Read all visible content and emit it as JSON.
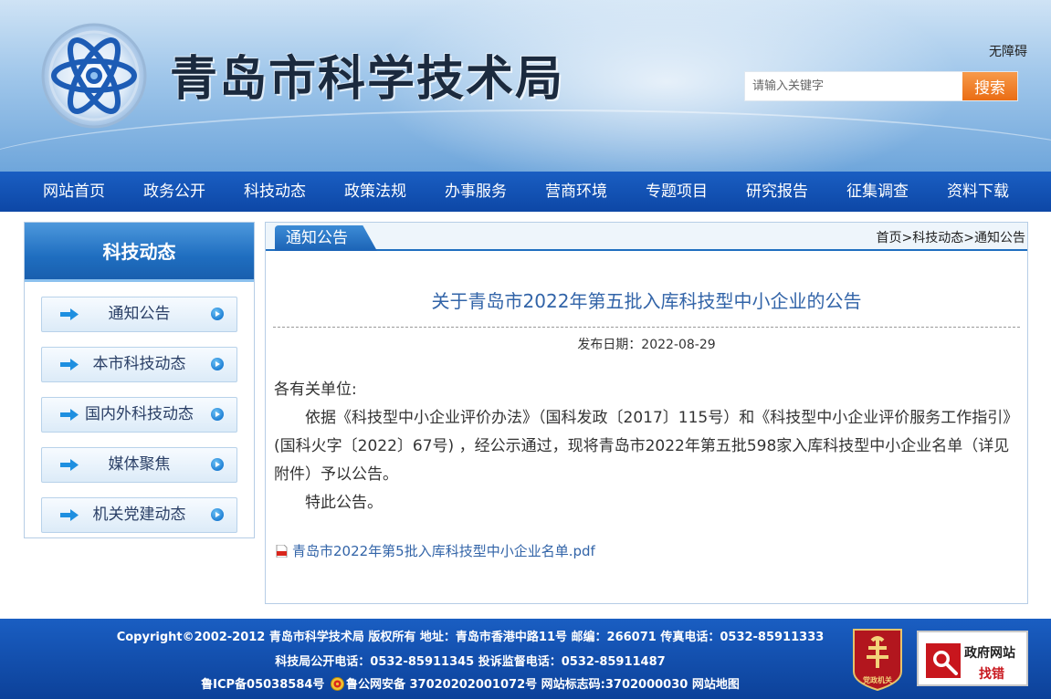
{
  "header": {
    "site_title": "青岛市科学技术局",
    "accessibility_link": "无障碍",
    "search_placeholder": "请输入关键字",
    "search_button": "搜索"
  },
  "nav": {
    "items": [
      "网站首页",
      "政务公开",
      "科技动态",
      "政策法规",
      "办事服务",
      "营商环境",
      "专题项目",
      "研究报告",
      "征集调查",
      "资料下载"
    ]
  },
  "sidebar": {
    "title": "科技动态",
    "items": [
      "通知公告",
      "本市科技动态",
      "国内外科技动态",
      "媒体聚焦",
      "机关党建动态"
    ]
  },
  "panel": {
    "tab_label": "通知公告",
    "breadcrumb": [
      "首页",
      "科技动态",
      "通知公告"
    ],
    "breadcrumb_sep": ">"
  },
  "article": {
    "title": "关于青岛市2022年第五批入库科技型中小企业的公告",
    "publish_date": "发布日期：2022-08-29",
    "salutation": "各有关单位:",
    "paragraph1": "依据《科技型中小企业评价办法》（国科发政〔2017〕115号）和《科技型中小企业评价服务工作指引》(国科火字〔2022〕67号) ，经公示通过，现将青岛市2022年第五批598家入库科技型中小企业名单（详见附件）予以公告。",
    "paragraph2": "特此公告。",
    "attachment": "青岛市2022年第5批入库科技型中小企业名单.pdf"
  },
  "footer": {
    "line1": "Copyright©2002-2012 青岛市科学技术局 版权所有 地址：青岛市香港中路11号 邮编：266071 传真电话：0532-85911333",
    "line2": "科技局公开电话：0532-85911345 投诉监督电话：0532-85911487",
    "icp": "鲁ICP备05038584号",
    "police": "鲁公网安备 37020202001072号",
    "site_code": "网站标志码:3702000030",
    "sitemap": "网站地图",
    "party_badge_text": "党政机关",
    "gov_badge_title": "政府网站",
    "gov_badge_action": "找错"
  },
  "colors": {
    "nav_blue": "#1558b8",
    "accent_orange": "#ea6d14",
    "link_blue": "#3264a8"
  }
}
